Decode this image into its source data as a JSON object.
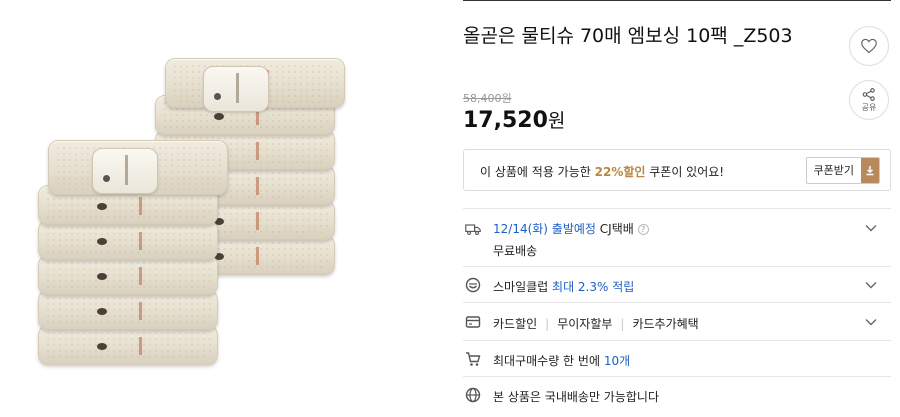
{
  "product": {
    "title": "올곧은 물티슈 70매 엠보싱 10팩 _Z503",
    "original_price": "58,400원",
    "price_number": "17,520",
    "price_unit": "원"
  },
  "actions": {
    "wish_icon": "heart-icon",
    "share_icon": "share-icon",
    "share_caption": "공유"
  },
  "coupon": {
    "text_before": "이 상품에 적용 가능한 ",
    "discount": "22%할인",
    "text_after": " 쿠폰이 있어요!",
    "button_label": "쿠폰받기",
    "button_icon": "download-icon"
  },
  "shipping": {
    "icon": "truck-icon",
    "date": "12/14(화) 출발예정",
    "carrier": "CJ택배",
    "help_icon": "question-icon",
    "fee": "무료배송"
  },
  "membership": {
    "icon": "smile-icon",
    "label": "스마일클럽",
    "benefit": "최대 2.3% 적립"
  },
  "card": {
    "icon": "card-icon",
    "items": [
      "카드할인",
      "무이자할부",
      "카드추가혜택"
    ]
  },
  "limit": {
    "icon": "cart-icon",
    "text": "최대구매수량 한 번에 ",
    "value": "10개"
  },
  "domestic": {
    "icon": "globe-icon",
    "text": "본 상품은 국내배송만 가능합니다"
  },
  "colors": {
    "accent_gold": "#b88940",
    "link_blue": "#1f5fc8",
    "coupon_button": "#b8895a"
  }
}
